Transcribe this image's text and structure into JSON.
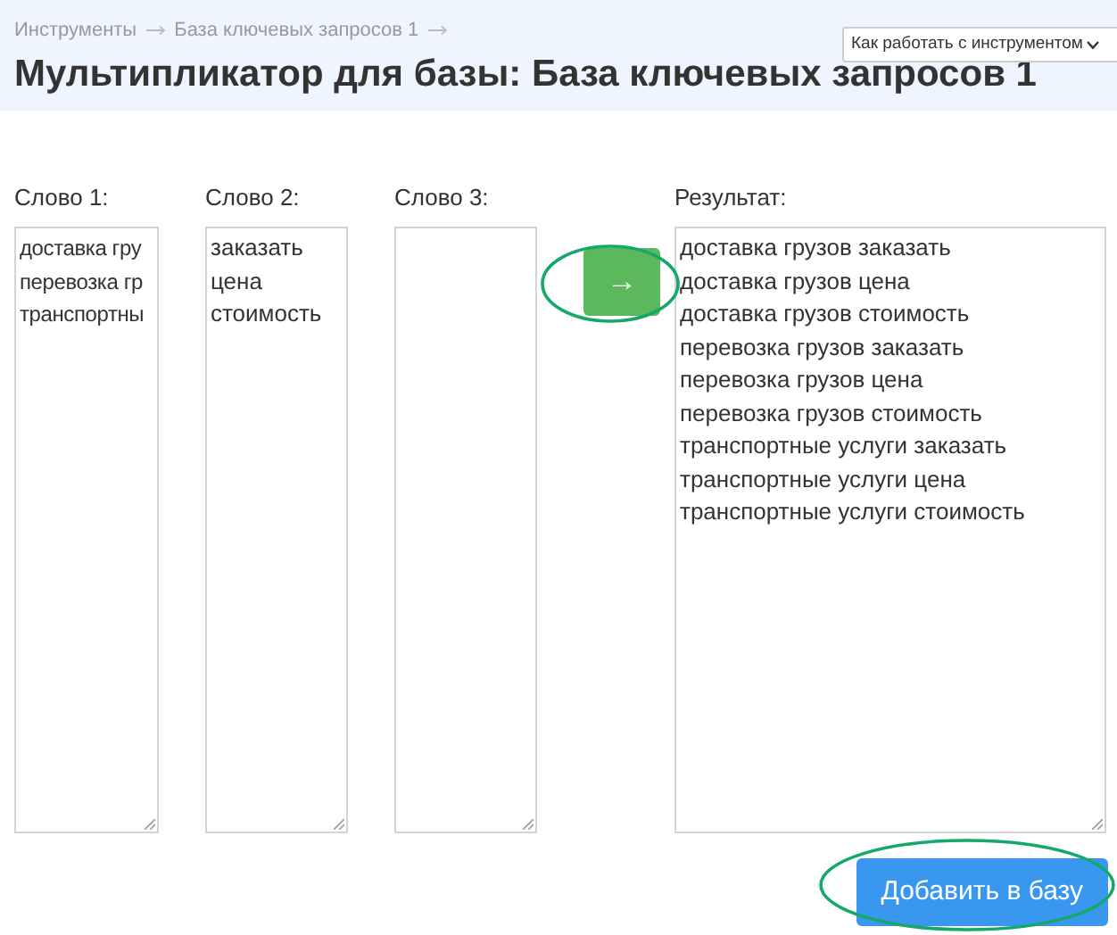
{
  "breadcrumbs": [
    {
      "label": "Инструменты"
    },
    {
      "label": "База ключевых запросов 1"
    }
  ],
  "help_dropdown": {
    "label": "Как работать с инструментом"
  },
  "title": "Мультипликатор для базы: База ключевых запросов 1",
  "columns": [
    {
      "label": "Слово 1:",
      "lines": [
        "доставка гру",
        "перевозка гр",
        "транспортны"
      ]
    },
    {
      "label": "Слово 2:",
      "lines": [
        "заказать",
        "цена",
        "стоимость"
      ]
    },
    {
      "label": "Слово 3:"
    }
  ],
  "multiply_button": {
    "label": "→"
  },
  "result": {
    "label": "Результат:",
    "lines": [
      "доставка грузов заказать",
      "доставка грузов цена",
      "доставка грузов стоимость",
      "перевозка грузов заказать",
      "перевозка грузов цена",
      "перевозка грузов стоимость",
      "транспортные услуги заказать",
      "транспортные услуги цена",
      "транспортные услуги стоимость"
    ]
  },
  "add_button": {
    "label": "Добавить в базу"
  }
}
